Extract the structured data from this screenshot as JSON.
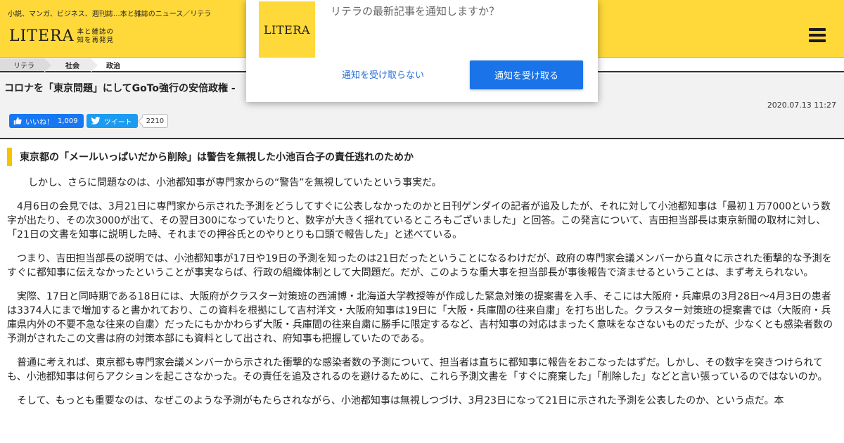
{
  "header": {
    "tagline": "小説、マンガ、ビジネス、週刊誌…本と雑誌のニュース／リテラ",
    "logo_word": "LITERA",
    "logo_sub": "本と雑誌の知を再発見",
    "menu_icon": "hamburger-menu-icon"
  },
  "breadcrumb": {
    "items": [
      "リテラ",
      "社会",
      "政治"
    ]
  },
  "article": {
    "title": "コロナを「東京問題」にしてGoTo強行の安倍政権 ‐",
    "date": "2020.07.13 11:27",
    "social": {
      "like_label": "いいね！",
      "like_count": "1,009",
      "tweet_label": "ツイート",
      "tweet_count": "2210"
    },
    "section_heading": "東京都の「メールいっぱいだから削除」は警告を無視した小池百合子の責任逃れのためか",
    "paragraphs": [
      "しかし、さらに問題なのは、小池都知事が専門家からの“警告”を無視していたという事実だ。",
      "4月6日の会見では、3月21日に専門家から示された予測をどうしてすぐに公表しなかったのかと日刊ゲンダイの記者が追及したが、それに対して小池都知事は「最初１万7000という数字が出たり、その次3000が出て、その翌日300になっていたりと、数字が大きく揺れているところもございました」と回答。この発言について、吉田担当部長は東京新聞の取材に対し、「21日の文書を知事に説明した時、それまでの押谷氏とのやりとりも口頭で報告した」と述べている。",
      "つまり、吉田担当部長の説明では、小池都知事が17日や19日の予測を知ったのは21日だったということになるわけだが、政府の専門家会議メンバーから直々に示された衝撃的な予測をすぐに都知事に伝えなかったということが事実ならば、行政の組織体制として大問題だ。だが、このような重大事を担当部長が事後報告で済ませるということは、まず考えられない。",
      "実際、17日と同時期である18日には、大阪府がクラスター対策班の西浦博・北海道大学教授等が作成した緊急対策の提案書を入手、そこには大阪府・兵庫県の3月28日〜4月3日の患者は3374人にまで増加すると書かれており、この資料を根拠にして吉村洋文・大阪府知事は19日に「大阪・兵庫間の往来自粛」を打ち出した。クラスター対策班の提案書では〈大阪府・兵庫県内外の不要不急な往来の自粛〉だったにもかかわらず大阪・兵庫間の往来自粛に勝手に限定するなど、吉村知事の対応はまったく意味をなさないものだったが、少なくとも感染者数の予測がされたこの文書は府の対策本部にも資料として出され、府知事も把握していたのである。",
      "普通に考えれば、東京都も専門家会議メンバーから示された衝撃的な感染者数の予測について、担当者は直ちに都知事に報告をおこなったはずだ。しかし、その数字を突きつけられても、小池都知事は何らアクションを起こさなかった。その責任を追及されるのを避けるために、これら予測文書を「すぐに廃棄した」「削除した」などと言い張っているのではないのか。",
      "そして、もっとも重要なのは、なぜこのような予測がもたらされながら、小池都知事は無視しつづけ、3月23日になって21日に示された予測を公表したのか、という点だ。本"
    ]
  },
  "notification": {
    "logo_word": "LITERA",
    "message": "リテラの最新記事を通知しますか？",
    "deny_label": "通知を受け取らない",
    "accept_label": "通知を受け取る"
  },
  "colors": {
    "brand_yellow": "#ffd83a",
    "heading_bar": "#f5c400",
    "facebook": "#1877f2",
    "twitter": "#1d9bf0",
    "accept_button": "#1a73e8"
  }
}
